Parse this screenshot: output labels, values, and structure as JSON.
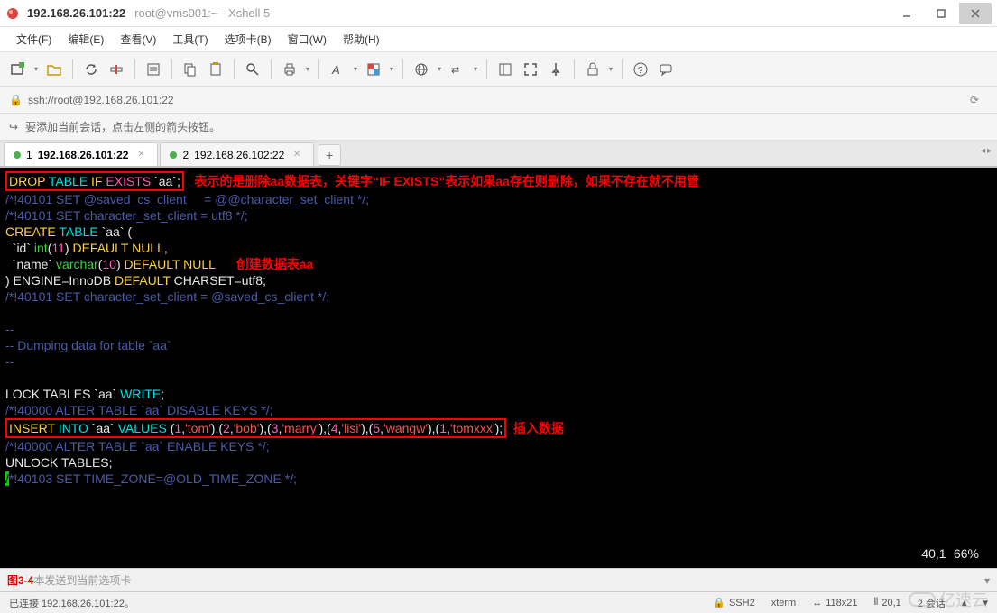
{
  "title": {
    "main": "192.168.26.101:22",
    "sub": "root@vms001:~ - Xshell 5"
  },
  "menu": {
    "file": "文件(F)",
    "edit": "编辑(E)",
    "view": "查看(V)",
    "tools": "工具(T)",
    "tabs": "选项卡(B)",
    "window": "窗口(W)",
    "help": "帮助(H)"
  },
  "address": {
    "url": "ssh://root@192.168.26.101:22"
  },
  "hint": {
    "text": "要添加当前会话，点击左侧的箭头按钮。"
  },
  "tabs": {
    "t1_num": "1",
    "t1": "192.168.26.101:22",
    "t2_num": "2",
    "t2": "192.168.26.102:22"
  },
  "annot": {
    "drop": "表示的是删除aa数据表，关键字“IF EXISTS”表示如果aa存在则删除，如果不存在就不用管",
    "create": "创建数据表aa",
    "insert": "插入数据",
    "fig": "图3-4"
  },
  "code": {
    "l1_drop": "DROP",
    "l1_table": " TABLE",
    "l1_if": " IF",
    "l1_exists": " EXISTS",
    "l1_tick": " `aa`;",
    "l2": "/*!40101 SET @saved_cs_client     = @@character_set_client */;",
    "l3": "/*!40101 SET character_set_client = utf8 */;",
    "l4_create": "CREATE",
    "l4_table": " TABLE",
    "l4_rest": " `aa` (",
    "l5_id": "  `id` ",
    "l5_int": "int",
    "l5_p": "(",
    "l5_11": "11",
    "l5_p2": ") ",
    "l5_def": "DEFAULT NULL",
    "l5_c": ",",
    "l6_name": "  `name` ",
    "l6_vc": "varchar",
    "l6_p": "(",
    "l6_10": "10",
    "l6_p2": ") ",
    "l6_def": "DEFAULT NULL",
    "l7_a": ") ENGINE=InnoDB ",
    "l7_def": "DEFAULT",
    "l7_b": " CHARSET=utf8;",
    "l8": "/*!40101 SET character_set_client = @saved_cs_client */;",
    "l9": "--",
    "l10": "-- Dumping data for table `aa`",
    "l11": "--",
    "l12_a": "LOCK TABLES `aa` ",
    "l12_w": "WRITE",
    "l12_s": ";",
    "l13": "/*!40000 ALTER TABLE `aa` DISABLE KEYS */;",
    "l14_ins": "INSERT",
    "l14_into": " INTO",
    "l14_aa": " `aa` ",
    "l14_val": "VALUES",
    "l14_sp": " (",
    "v1n": "1",
    "c": ",",
    "q": "'",
    "v1s": "tom",
    "pc": "),(",
    "v2n": "2",
    "v2s": "bob",
    "v3n": "3",
    "v3s": "marry",
    "v4n": "4",
    "v4s": "lisi",
    "v5n": "5",
    "v5s": "wangw",
    "v6n": "1",
    "v6s": "tomxxx",
    "end": ");",
    "l15": "/*!40000 ALTER TABLE `aa` ENABLE KEYS */;",
    "l16": "UNLOCK TABLES;",
    "l17_a": "*!40103 SET TIME_ZONE=@OLD_TIME_ZONE */;"
  },
  "termstatus": {
    "pos": "40,1",
    "pct": "66%"
  },
  "sendbar": {
    "text": "本发送到当前选项卡"
  },
  "status": {
    "conn": "已连接 192.168.26.101:22。",
    "ssh": "SSH2",
    "term": "xterm",
    "size": "118x21",
    "cursor": "20,1",
    "sess": "2 会话"
  },
  "watermark": "亿速云"
}
